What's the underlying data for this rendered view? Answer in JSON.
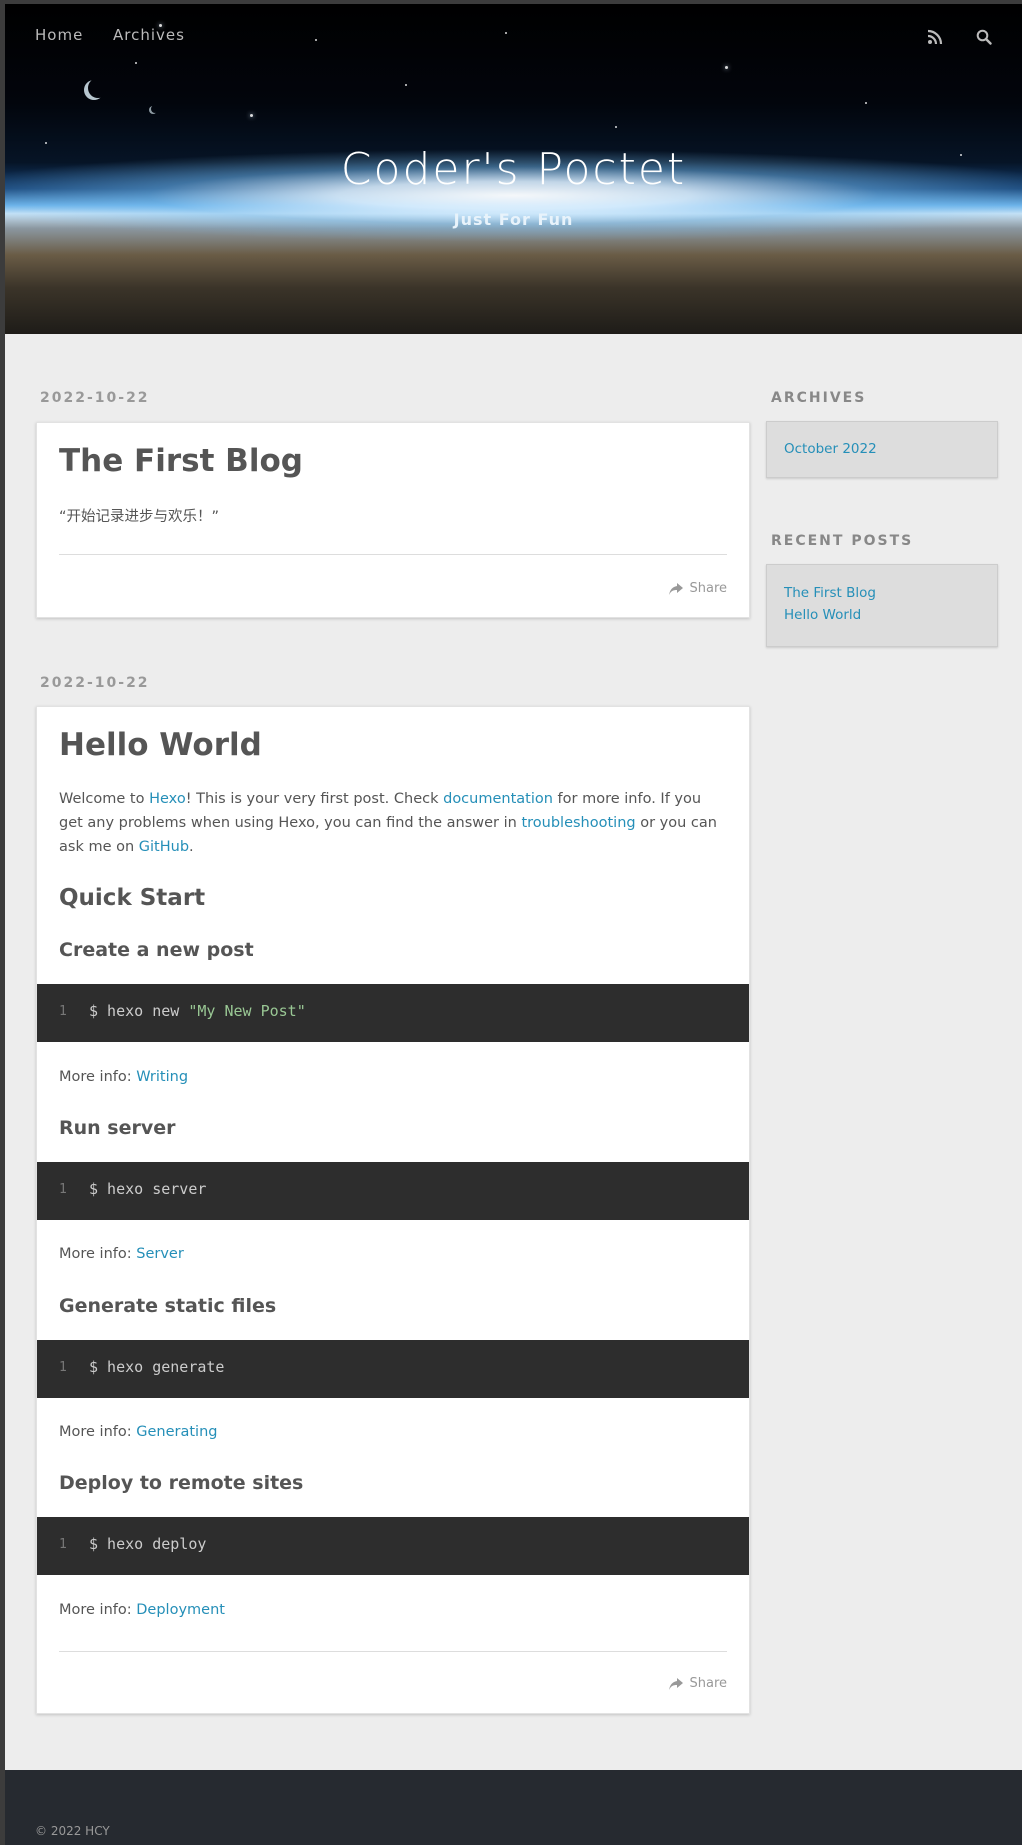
{
  "site": {
    "title": "Coder's Poctet",
    "subtitle": "Just For Fun"
  },
  "nav": {
    "items": [
      {
        "label": "Home"
      },
      {
        "label": "Archives"
      }
    ],
    "rss_icon": "rss-icon",
    "search_icon": "search-icon"
  },
  "posts": [
    {
      "date": "2022-10-22",
      "title": "The First Blog",
      "excerpt": "“开始记录进步与欢乐！”",
      "share_label": "Share"
    },
    {
      "date": "2022-10-22",
      "title": "Hello World",
      "intro": {
        "t1": "Welcome to ",
        "link_hexo": "Hexo",
        "t2": "! This is your very first post. Check ",
        "link_docs": "documentation",
        "t3": " for more info. If you get any problems when using Hexo, you can find the answer in ",
        "link_trouble": "troubleshooting",
        "t4": " or you can ask me on ",
        "link_github": "GitHub",
        "t5": "."
      },
      "quick_start": "Quick Start",
      "sections": [
        {
          "heading": "Create a new post",
          "line_no": "1",
          "code_cmd": "$ hexo new ",
          "code_str": "\"My New Post\"",
          "more_label": "More info: ",
          "more_link": "Writing"
        },
        {
          "heading": "Run server",
          "line_no": "1",
          "code_cmd": "$ hexo server",
          "code_str": "",
          "more_label": "More info: ",
          "more_link": "Server"
        },
        {
          "heading": "Generate static files",
          "line_no": "1",
          "code_cmd": "$ hexo generate",
          "code_str": "",
          "more_label": "More info: ",
          "more_link": "Generating"
        },
        {
          "heading": "Deploy to remote sites",
          "line_no": "1",
          "code_cmd": "$ hexo deploy",
          "code_str": "",
          "more_label": "More info: ",
          "more_link": "Deployment"
        }
      ],
      "share_label": "Share"
    }
  ],
  "sidebar": {
    "archives_title": "ARCHIVES",
    "archives": [
      {
        "label": "October 2022"
      }
    ],
    "recent_title": "RECENT POSTS",
    "recent": [
      {
        "label": "The First Blog"
      },
      {
        "label": "Hello World"
      }
    ]
  },
  "footer": {
    "copyright": "© 2022 HCY"
  },
  "colors": {
    "link": "#258fb8",
    "code_bg": "#2d2d2d",
    "footer_bg": "#262a30",
    "page_bg": "#ededed"
  }
}
